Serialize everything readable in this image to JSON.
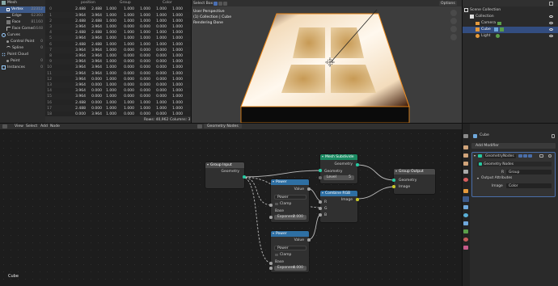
{
  "spreadsheet": {
    "menu": [
      "View",
      "Select",
      "Add",
      "Node"
    ],
    "tree": {
      "mesh": {
        "label": "Mesh"
      },
      "vertex": {
        "label": "Vertex",
        "count": "22312"
      },
      "edge": {
        "label": "Edge",
        "count": "62360"
      },
      "face": {
        "label": "Face",
        "count": "81160"
      },
      "face_corner": {
        "label": "Face Corner",
        "count": "5648"
      },
      "curves": {
        "label": "Curves"
      },
      "control_point": {
        "label": "Control Point",
        "count": "0"
      },
      "spline": {
        "label": "Spline",
        "count": "0"
      },
      "point_cloud": {
        "label": "Point Cloud"
      },
      "point": {
        "label": "Point",
        "count": "0"
      },
      "instances": {
        "label": "Instances",
        "count": "0"
      }
    },
    "headers": {
      "position": "position",
      "group": "Group",
      "color": "Color"
    },
    "rows": [
      [
        "0",
        "2.488",
        "2.488",
        "1.000",
        "1.000",
        "1.000",
        "1.000",
        "1.000"
      ],
      [
        "1",
        "3.964",
        "3.964",
        "1.000",
        "1.000",
        "1.000",
        "1.000",
        "1.000"
      ],
      [
        "2",
        "2.488",
        "2.488",
        "1.000",
        "1.000",
        "1.000",
        "1.000",
        "1.000"
      ],
      [
        "3",
        "3.964",
        "3.964",
        "1.000",
        "0.000",
        "0.000",
        "0.000",
        "1.000"
      ],
      [
        "4",
        "2.488",
        "2.488",
        "1.000",
        "1.000",
        "1.000",
        "1.000",
        "1.000"
      ],
      [
        "5",
        "3.964",
        "3.964",
        "1.000",
        "1.000",
        "1.000",
        "1.000",
        "1.000"
      ],
      [
        "6",
        "2.488",
        "2.488",
        "1.000",
        "1.000",
        "1.000",
        "1.000",
        "1.000"
      ],
      [
        "7",
        "3.964",
        "3.964",
        "1.000",
        "0.000",
        "0.000",
        "0.000",
        "1.000"
      ],
      [
        "8",
        "3.964",
        "3.964",
        "1.000",
        "0.000",
        "0.000",
        "0.000",
        "1.000"
      ],
      [
        "9",
        "3.964",
        "3.964",
        "1.000",
        "0.000",
        "0.000",
        "0.000",
        "1.000"
      ],
      [
        "10",
        "3.964",
        "3.964",
        "1.000",
        "0.000",
        "0.000",
        "0.000",
        "1.000"
      ],
      [
        "11",
        "3.964",
        "3.964",
        "1.000",
        "0.000",
        "0.000",
        "0.000",
        "1.000"
      ],
      [
        "12",
        "3.964",
        "0.000",
        "1.000",
        "0.000",
        "0.000",
        "0.000",
        "1.000"
      ],
      [
        "13",
        "3.964",
        "0.000",
        "1.000",
        "0.000",
        "0.000",
        "0.000",
        "1.000"
      ],
      [
        "14",
        "3.964",
        "0.000",
        "1.000",
        "0.000",
        "0.000",
        "0.000",
        "1.000"
      ],
      [
        "15",
        "3.964",
        "0.000",
        "1.000",
        "0.000",
        "0.000",
        "0.000",
        "1.000"
      ],
      [
        "16",
        "2.488",
        "0.000",
        "1.000",
        "1.000",
        "1.000",
        "1.000",
        "1.000"
      ],
      [
        "17",
        "2.488",
        "0.000",
        "1.000",
        "1.000",
        "1.000",
        "1.000",
        "1.000"
      ],
      [
        "18",
        "0.000",
        "3.964",
        "1.000",
        "0.000",
        "0.000",
        "0.000",
        "1.000"
      ]
    ],
    "status": {
      "rows": "Rows: 40,962",
      "columns": "Columns: 3"
    }
  },
  "viewport": {
    "select_mode": "Select Box",
    "view_info": "User Perspective",
    "collection": "(1) Collection | Cube",
    "render": "Rendering Done",
    "options": "Options"
  },
  "outliner": {
    "title": "Scene Collection",
    "items": [
      {
        "label": "Collection"
      },
      {
        "label": "Camera"
      },
      {
        "label": "Cube"
      },
      {
        "label": "Light"
      }
    ]
  },
  "node_editor": {
    "menu": [
      "View",
      "Select",
      "Add",
      "Node"
    ],
    "tree_name": "Geometry Nodes",
    "object_label": "Cube",
    "nodes": {
      "group_input": {
        "title": "Group Input",
        "out": "Geometry"
      },
      "mesh_subdiv": {
        "title": "Mesh Subdivide",
        "out": "Geometry",
        "in": "Geometry",
        "level_label": "Level",
        "level": "5"
      },
      "group_output": {
        "title": "Group Output",
        "geo": "Geometry",
        "img": "Image"
      },
      "power1": {
        "title": "Power",
        "out": "Value",
        "mode": "Power",
        "clamp": "Clamp",
        "base": "Base",
        "exp_label": "Exponent",
        "exp": "2.000"
      },
      "combine_rgb": {
        "title": "Combine RGB",
        "out": "Image",
        "r": "R",
        "g": "G",
        "b": "B"
      },
      "power2": {
        "title": "Power",
        "out": "Value",
        "mode": "Power",
        "clamp": "Clamp",
        "base": "Base",
        "exp_label": "Exponent",
        "exp": "4.000"
      }
    }
  },
  "properties": {
    "object": "Cube",
    "add_modifier": "Add Modifier",
    "modifier_name": "GeometryNodes",
    "tree": "Geometry Nodes",
    "r_label": "R",
    "r_value": "Group",
    "output_attr": "Output Attributes",
    "image_label": "Image",
    "image_value": "Color"
  }
}
